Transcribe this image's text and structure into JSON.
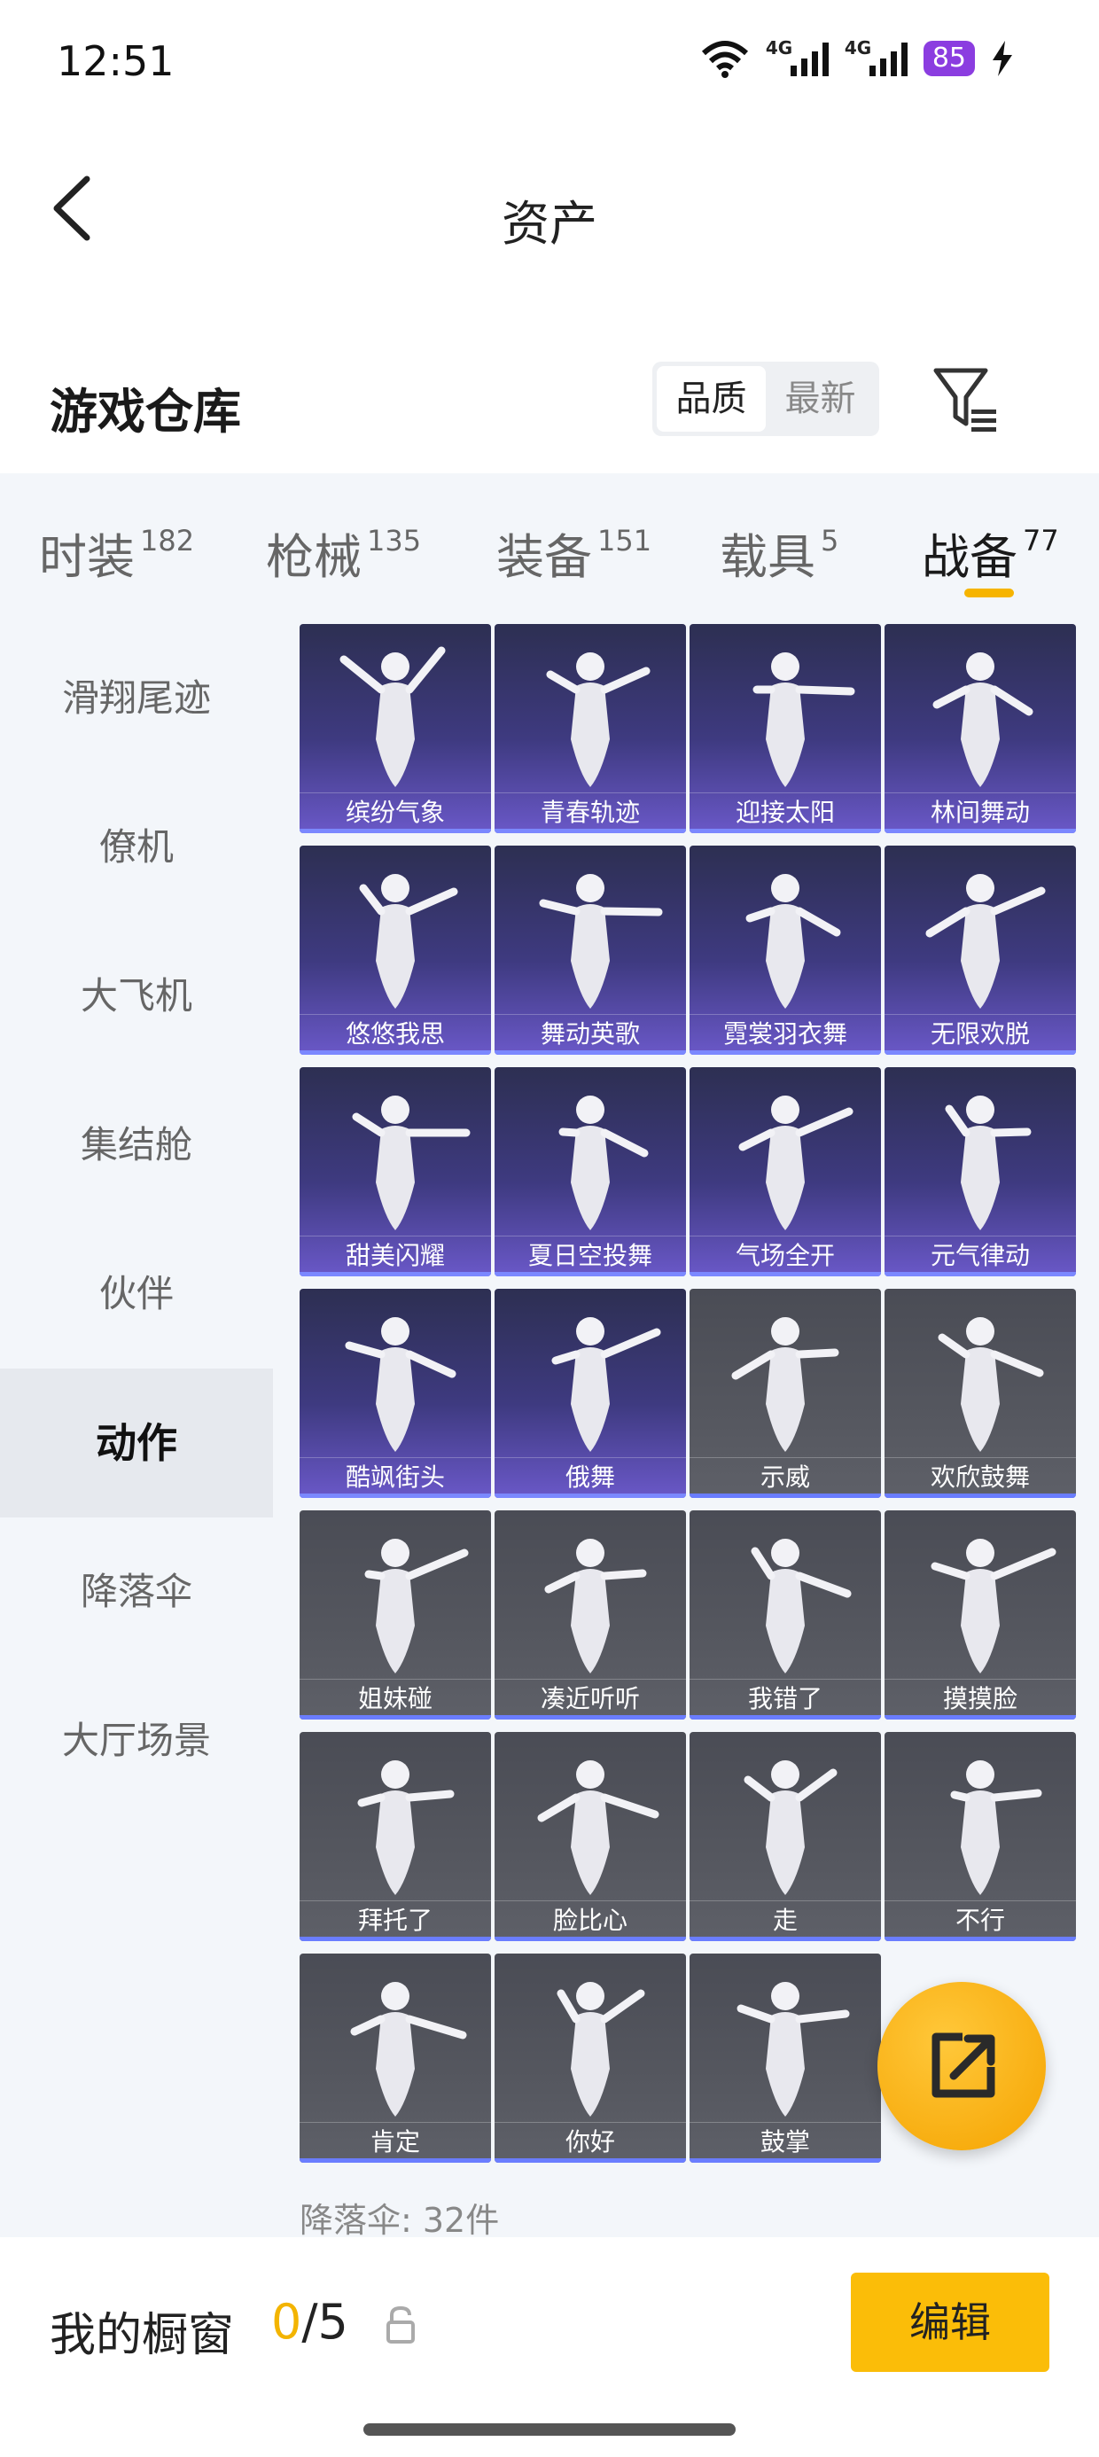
{
  "status_bar": {
    "time": "12:51",
    "battery": "85",
    "net1": "4G",
    "net2": "4G"
  },
  "header": {
    "title": "资产"
  },
  "section": {
    "title": "游戏仓库",
    "sort_options": [
      "品质",
      "最新"
    ],
    "active_sort": "品质"
  },
  "tabs": [
    {
      "label": "时装",
      "count": "182"
    },
    {
      "label": "枪械",
      "count": "135"
    },
    {
      "label": "装备",
      "count": "151"
    },
    {
      "label": "载具",
      "count": "5"
    },
    {
      "label": "战备",
      "count": "77",
      "active": true
    }
  ],
  "sidebar": [
    "滑翔尾迹",
    "僚机",
    "大飞机",
    "集结舱",
    "伙伴",
    "动作",
    "降落伞",
    "大厅场景"
  ],
  "sidebar_active": "动作",
  "items": [
    {
      "name": "缤纷气象",
      "rarity": "epic"
    },
    {
      "name": "青春轨迹",
      "rarity": "epic"
    },
    {
      "name": "迎接太阳",
      "rarity": "epic"
    },
    {
      "name": "林间舞动",
      "rarity": "epic"
    },
    {
      "name": "悠悠我思",
      "rarity": "epic"
    },
    {
      "name": "舞动英歌",
      "rarity": "epic"
    },
    {
      "name": "霓裳羽衣舞",
      "rarity": "epic"
    },
    {
      "name": "无限欢脱",
      "rarity": "epic"
    },
    {
      "name": "甜美闪耀",
      "rarity": "epic"
    },
    {
      "name": "夏日空投舞",
      "rarity": "epic"
    },
    {
      "name": "气场全开",
      "rarity": "epic"
    },
    {
      "name": "元气律动",
      "rarity": "epic"
    },
    {
      "name": "酷飒街头",
      "rarity": "epic"
    },
    {
      "name": "俄舞",
      "rarity": "epic"
    },
    {
      "name": "示威",
      "rarity": "common"
    },
    {
      "name": "欢欣鼓舞",
      "rarity": "common"
    },
    {
      "name": "姐妹碰",
      "rarity": "common"
    },
    {
      "name": "凑近听听",
      "rarity": "common"
    },
    {
      "name": "我错了",
      "rarity": "common"
    },
    {
      "name": "摸摸脸",
      "rarity": "common"
    },
    {
      "name": "拜托了",
      "rarity": "common"
    },
    {
      "name": "脸比心",
      "rarity": "common"
    },
    {
      "name": "走",
      "rarity": "common"
    },
    {
      "name": "不行",
      "rarity": "common"
    },
    {
      "name": "肯定",
      "rarity": "common"
    },
    {
      "name": "你好",
      "rarity": "common"
    },
    {
      "name": "鼓掌",
      "rarity": "common"
    }
  ],
  "next_section": {
    "label": "降落伞: 32件"
  },
  "bottom": {
    "showcase_label": "我的橱窗",
    "showcase_current": "0",
    "showcase_total": "/5",
    "edit_label": "编辑"
  },
  "colors": {
    "accent": "#fbbd08",
    "epic": "#4a3f9a",
    "common": "#55575f"
  }
}
